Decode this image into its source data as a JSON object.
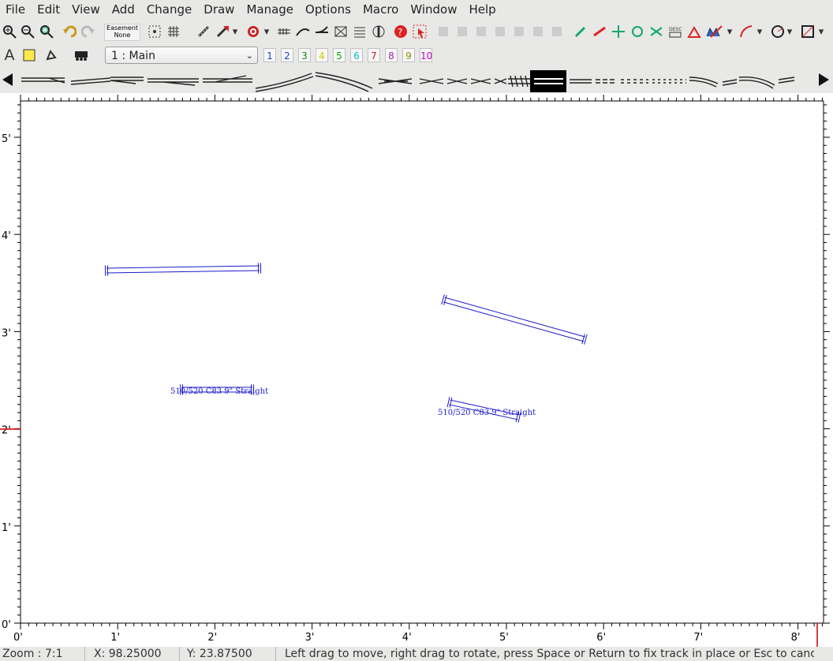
{
  "menubar": {
    "items": [
      "File",
      "Edit",
      "View",
      "Add",
      "Change",
      "Draw",
      "Manage",
      "Options",
      "Macro",
      "Window",
      "Help"
    ]
  },
  "toolbar": {
    "easement_title": "Easement",
    "easement_value": "None",
    "layer_selected": "1 : Main",
    "layer_buttons": [
      {
        "label": "1",
        "color": "#1f3fd0"
      },
      {
        "label": "2",
        "color": "#1f3fd0"
      },
      {
        "label": "3",
        "color": "#0a8a0a"
      },
      {
        "label": "4",
        "color": "#cfcf00"
      },
      {
        "label": "5",
        "color": "#00b000"
      },
      {
        "label": "6",
        "color": "#00bcd4"
      },
      {
        "label": "7",
        "color": "#d02020"
      },
      {
        "label": "8",
        "color": "#9c27b0"
      },
      {
        "label": "9",
        "color": "#8c8c00"
      },
      {
        "label": "10",
        "color": "#c000c0"
      }
    ]
  },
  "canvas": {
    "x_axis_labels": [
      "0'",
      "1'",
      "2'",
      "3'",
      "4'",
      "5'",
      "6'",
      "7'",
      "8'"
    ],
    "y_axis_labels": [
      "0'",
      "1'",
      "2'",
      "3'",
      "4'",
      "5'"
    ],
    "track_labels": [
      "510/520 C83 9\" Straight",
      "510/520 C83 9\" Straight"
    ],
    "track_color": "#1a1acc"
  },
  "status": {
    "zoom": "Zoom : 7:1",
    "x": "X: 98.25000",
    "y": "Y: 23.87500",
    "message": "Left drag to move, right drag to rotate, press Space or Return to fix track in place or Esc to cancel"
  }
}
